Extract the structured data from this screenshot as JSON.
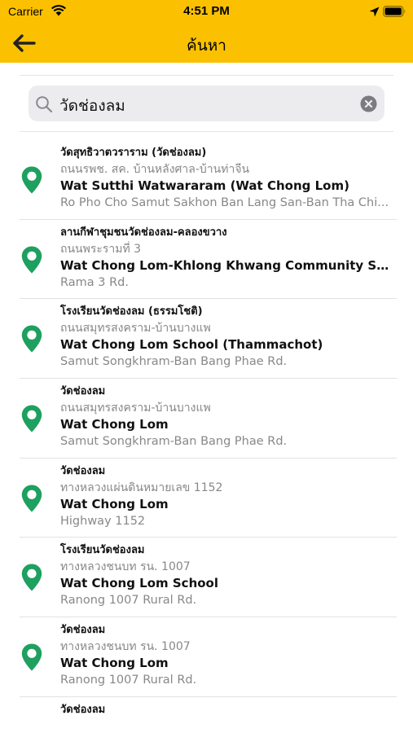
{
  "status_bar": {
    "carrier": "Carrier",
    "time": "4:51 PM"
  },
  "nav": {
    "title": "ค้นหา",
    "back_icon": "back-arrow-icon"
  },
  "search": {
    "value": "วัดช่องลม",
    "search_icon": "search-icon",
    "clear_icon": "clear-icon"
  },
  "colors": {
    "header": "#fbc100",
    "pin": "#1ea05f"
  },
  "results": [
    {
      "name_th": "วัดสุทธิวาตวราราม (วัดช่องลม)",
      "road_th": "ถนนรพช. สค. บ้านหลังศาล-บ้านท่าจีน",
      "name_en": "Wat Sutthi Watwararam (Wat Chong Lom)",
      "road_en": "Ro Pho Cho Samut Sakhon Ban Lang San-Ban Tha Chi..."
    },
    {
      "name_th": "ลานกีฬาชุมชนวัดช่องลม-คลองขวาง",
      "road_th": "ถนนพระรามที่ 3",
      "name_en": "Wat Chong Lom-Khlong Khwang Community Sport...",
      "road_en": "Rama 3 Rd."
    },
    {
      "name_th": "โรงเรียนวัดช่องลม (ธรรมโชติ)",
      "road_th": "ถนนสมุทรสงคราม-บ้านบางแพ",
      "name_en": "Wat Chong Lom School (Thammachot)",
      "road_en": "Samut Songkhram-Ban Bang Phae Rd."
    },
    {
      "name_th": "วัดช่องลม",
      "road_th": "ถนนสมุทรสงคราม-บ้านบางแพ",
      "name_en": "Wat Chong Lom",
      "road_en": "Samut Songkhram-Ban Bang Phae Rd."
    },
    {
      "name_th": "วัดช่องลม",
      "road_th": "ทางหลวงแผ่นดินหมายเลข 1152",
      "name_en": "Wat Chong Lom",
      "road_en": "Highway 1152"
    },
    {
      "name_th": "โรงเรียนวัดช่องลม",
      "road_th": "ทางหลวงชนบท รน. 1007",
      "name_en": "Wat Chong Lom School",
      "road_en": "Ranong 1007 Rural Rd."
    },
    {
      "name_th": "วัดช่องลม",
      "road_th": "ทางหลวงชนบท รน. 1007",
      "name_en": "Wat Chong Lom",
      "road_en": "Ranong 1007 Rural Rd."
    }
  ],
  "partial_row": {
    "name_th": "วัดช่องลม"
  }
}
